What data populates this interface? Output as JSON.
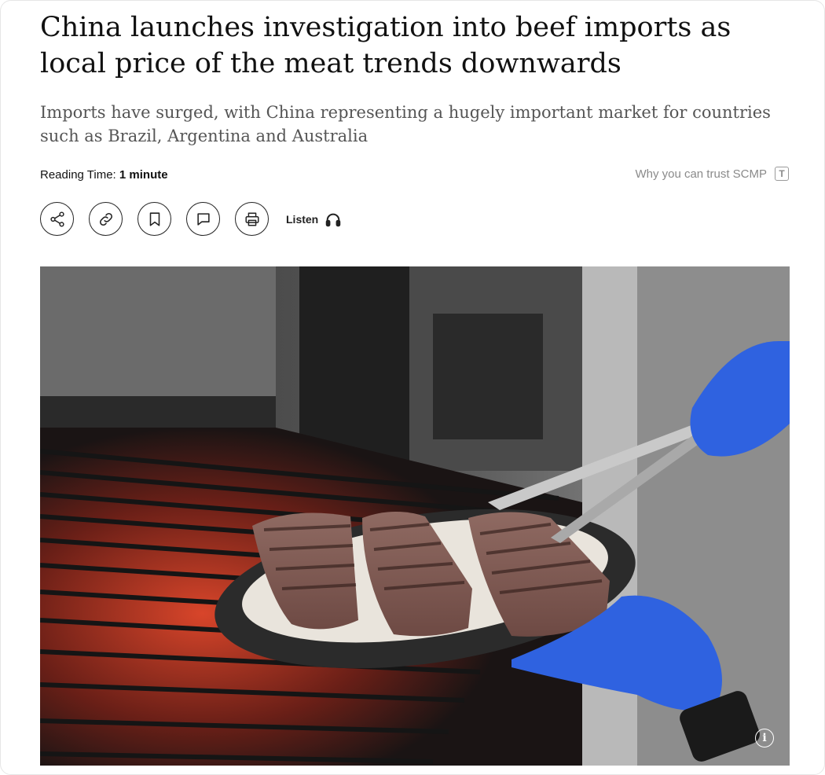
{
  "article": {
    "headline": "China launches investigation into beef imports as local price of the meat trends downwards",
    "subheadline": "Imports have surged, with China representing a hugely important market for countries such as Brazil, Argentina and Australia",
    "reading_time_label": "Reading Time:",
    "reading_time_value": "1 minute",
    "trust_text": "Why you can trust SCMP",
    "trust_icon_letter": "T"
  },
  "toolbar": {
    "buttons": [
      {
        "name": "share-icon"
      },
      {
        "name": "link-icon"
      },
      {
        "name": "bookmark-icon"
      },
      {
        "name": "comment-icon"
      },
      {
        "name": "print-icon"
      }
    ],
    "listen_label": "Listen"
  },
  "image": {
    "info_glyph": "i",
    "subject": "steaks on a plate held by tongs over a grill",
    "colors": {
      "glove": "#2f62e0",
      "grill_glow": "#c8321e",
      "plate_rim": "#2b2b2b"
    }
  }
}
